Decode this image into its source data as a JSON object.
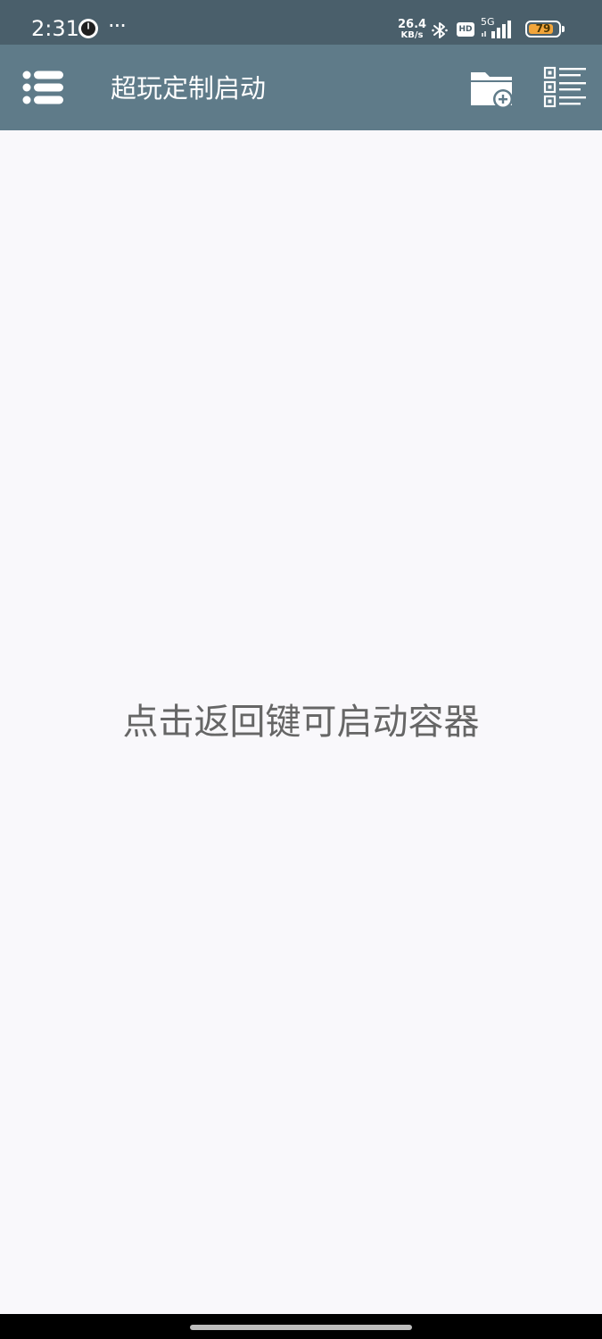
{
  "status_bar": {
    "time": "2:31",
    "more": "···",
    "speed_value": "26.4",
    "speed_unit": "KB/s",
    "hd": "HD",
    "network": "5G",
    "battery_level": "79",
    "icons": [
      "clock-icon",
      "bluetooth-icon",
      "signal-icon",
      "battery-icon"
    ]
  },
  "app_bar": {
    "title": "超玩定制启动",
    "background_color": "#5f7b89",
    "icons": [
      "menu-icon",
      "new-folder-icon",
      "list-view-icon"
    ]
  },
  "content": {
    "hint": "点击返回键可启动容器"
  }
}
